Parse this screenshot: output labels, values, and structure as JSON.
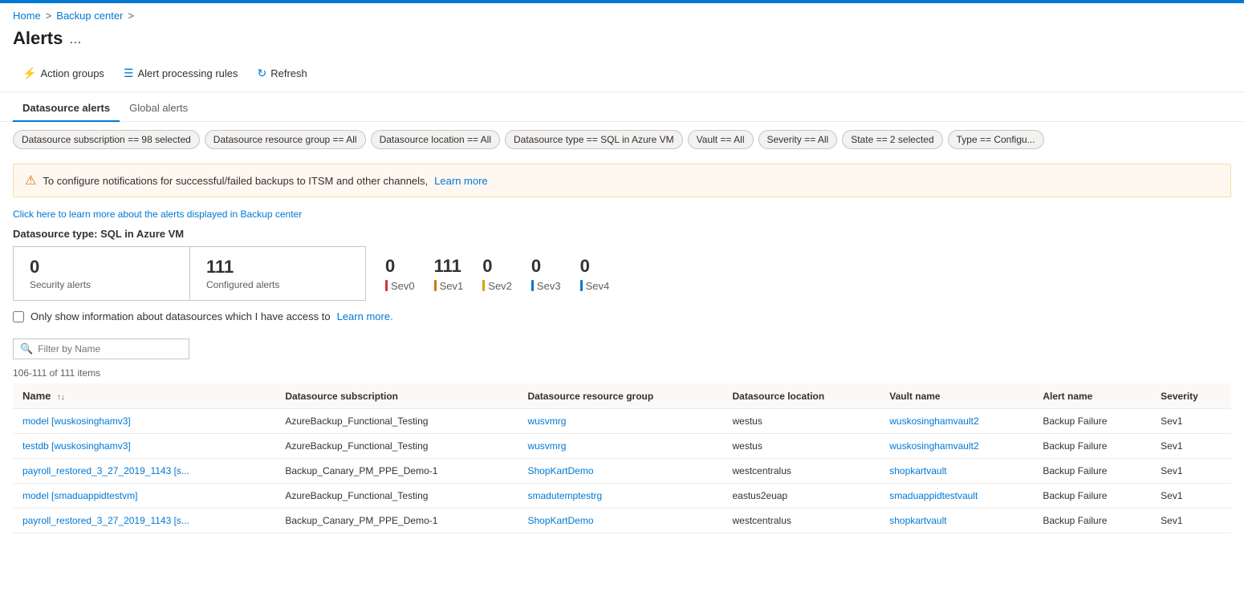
{
  "topBar": {},
  "breadcrumb": {
    "home": "Home",
    "separator1": ">",
    "backupCenter": "Backup center",
    "separator2": ">"
  },
  "pageHeader": {
    "title": "Alerts",
    "dots": "..."
  },
  "toolbar": {
    "actionGroups": "Action groups",
    "alertProcessingRules": "Alert processing rules",
    "refresh": "Refresh"
  },
  "tabs": [
    {
      "label": "Datasource alerts",
      "active": true
    },
    {
      "label": "Global alerts",
      "active": false
    }
  ],
  "filters": [
    {
      "label": "Datasource subscription == 98 selected"
    },
    {
      "label": "Datasource resource group == All"
    },
    {
      "label": "Datasource location == All"
    },
    {
      "label": "Datasource type == SQL in Azure VM"
    },
    {
      "label": "Vault == All"
    },
    {
      "label": "Severity == All"
    },
    {
      "label": "State == 2 selected"
    },
    {
      "label": "Type == Configu..."
    }
  ],
  "warningBar": {
    "text": "To configure notifications for successful/failed backups to ITSM and other channels,",
    "learnMore": "Learn more"
  },
  "infoLink": "Click here to learn more about the alerts displayed in Backup center",
  "datasourceLabel": "Datasource type: SQL in Azure VM",
  "stats": {
    "security": {
      "num": "0",
      "label": "Security alerts"
    },
    "configured": {
      "num": "111",
      "label": "Configured alerts"
    }
  },
  "sevStats": [
    {
      "num": "0",
      "label": "Sev0",
      "color": "#d13438"
    },
    {
      "num": "111",
      "label": "Sev1",
      "color": "#d47500"
    },
    {
      "num": "0",
      "label": "Sev2",
      "color": "#d6a30a"
    },
    {
      "num": "0",
      "label": "Sev3",
      "color": "#0078d4"
    },
    {
      "num": "0",
      "label": "Sev4",
      "color": "#0078d4"
    }
  ],
  "checkboxRow": {
    "label": "Only show information about datasources which I have access to",
    "learnMore": "Learn more."
  },
  "filterInput": {
    "placeholder": "Filter by Name"
  },
  "itemsCount": "106-111 of 111 items",
  "tableHeaders": [
    "Name",
    "Datasource subscription",
    "Datasource resource group",
    "Datasource location",
    "Vault name",
    "Alert name",
    "Severity"
  ],
  "tableRows": [
    {
      "name": "model [wuskosinghamv3]",
      "subscription": "AzureBackup_Functional_Testing",
      "resourceGroup": "wusvmrg",
      "location": "westus",
      "vaultName": "wuskosinghamvault2",
      "alertName": "Backup Failure",
      "severity": "Sev1"
    },
    {
      "name": "testdb [wuskosinghamv3]",
      "subscription": "AzureBackup_Functional_Testing",
      "resourceGroup": "wusvmrg",
      "location": "westus",
      "vaultName": "wuskosinghamvault2",
      "alertName": "Backup Failure",
      "severity": "Sev1"
    },
    {
      "name": "payroll_restored_3_27_2019_1143 [s...",
      "subscription": "Backup_Canary_PM_PPE_Demo-1",
      "resourceGroup": "ShopKartDemo",
      "location": "westcentralus",
      "vaultName": "shopkartvault",
      "alertName": "Backup Failure",
      "severity": "Sev1"
    },
    {
      "name": "model [smaduappidtestvm]",
      "subscription": "AzureBackup_Functional_Testing",
      "resourceGroup": "smadutemptestrg",
      "location": "eastus2euap",
      "vaultName": "smaduappidtestvault",
      "alertName": "Backup Failure",
      "severity": "Sev1"
    },
    {
      "name": "payroll_restored_3_27_2019_1143 [s...",
      "subscription": "Backup_Canary_PM_PPE_Demo-1",
      "resourceGroup": "ShopKartDemo",
      "location": "westcentralus",
      "vaultName": "shopkartvault",
      "alertName": "Backup Failure",
      "severity": "Sev1"
    }
  ]
}
